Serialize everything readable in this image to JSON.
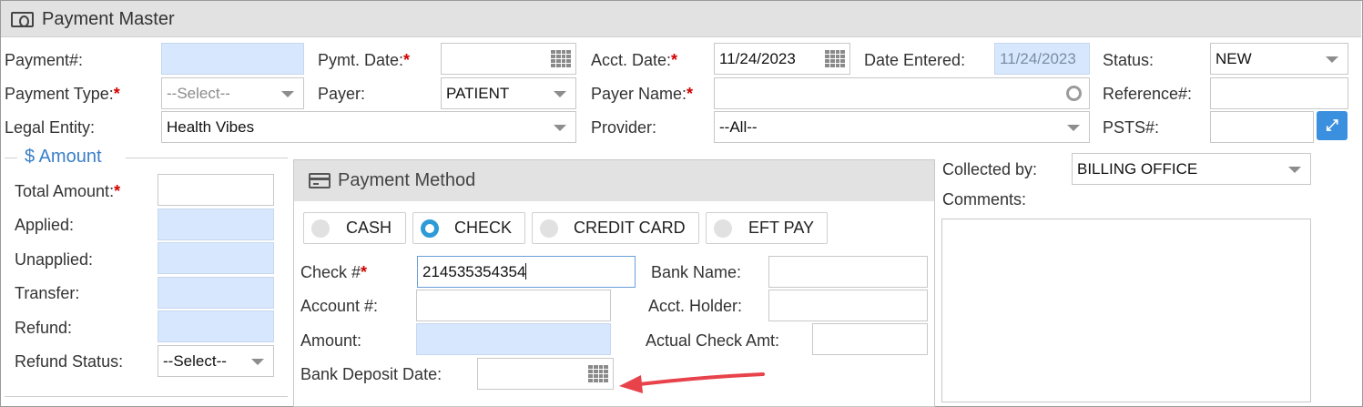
{
  "window": {
    "title": "Payment Master",
    "icon": "money-icon"
  },
  "header_fields": {
    "payment_no": {
      "label": "Payment#:",
      "value": ""
    },
    "pymt_date": {
      "label": "Pymt. Date:",
      "required": "*",
      "value": ""
    },
    "acct_date": {
      "label": "Acct. Date:",
      "required": "*",
      "value": "11/24/2023"
    },
    "date_entered": {
      "label": "Date Entered:",
      "value": "11/24/2023"
    },
    "status": {
      "label": "Status:",
      "value": "NEW"
    },
    "payment_type": {
      "label": "Payment Type:",
      "required": "*",
      "value": "--Select--"
    },
    "payer": {
      "label": "Payer:",
      "value": "PATIENT"
    },
    "payer_name": {
      "label": "Payer Name:",
      "required": "*",
      "value": ""
    },
    "reference_no": {
      "label": "Reference#:",
      "value": ""
    },
    "legal_entity": {
      "label": "Legal Entity:",
      "value": "Health Vibes"
    },
    "provider": {
      "label": "Provider:",
      "value": "--All--"
    },
    "psts_no": {
      "label": "PSTS#:",
      "value": ""
    }
  },
  "amount": {
    "legend": "$ Amount",
    "total_amount": {
      "label": "Total Amount:",
      "required": "*",
      "value": ""
    },
    "applied": {
      "label": "Applied:",
      "value": ""
    },
    "unapplied": {
      "label": "Unapplied:",
      "value": ""
    },
    "transfer": {
      "label": "Transfer:",
      "value": ""
    },
    "refund": {
      "label": "Refund:",
      "value": ""
    },
    "refund_status": {
      "label": "Refund Status:",
      "value": "--Select--"
    }
  },
  "payment_method": {
    "title": "Payment Method",
    "options": [
      {
        "label": "CASH",
        "selected": false
      },
      {
        "label": "CHECK",
        "selected": true
      },
      {
        "label": "CREDIT CARD",
        "selected": false
      },
      {
        "label": "EFT PAY",
        "selected": false
      }
    ],
    "check_no": {
      "label": "Check #",
      "required": "*",
      "value": "214535354354"
    },
    "bank_name": {
      "label": "Bank Name:",
      "value": ""
    },
    "account_no": {
      "label": "Account #:",
      "value": ""
    },
    "acct_holder": {
      "label": "Acct. Holder:",
      "value": ""
    },
    "amount": {
      "label": "Amount:",
      "value": ""
    },
    "actual_check_amt": {
      "label": "Actual Check Amt:",
      "value": ""
    },
    "bank_deposit_date": {
      "label": "Bank Deposit Date:",
      "value": ""
    }
  },
  "collected_by": {
    "label": "Collected by:",
    "value": "BILLING OFFICE"
  },
  "comments": {
    "label": "Comments:",
    "value": ""
  },
  "colors": {
    "accent": "#3a8fde",
    "required": "#d20000",
    "readonly_fill": "#d7e7fd",
    "annotation_arrow": "#e8424a"
  }
}
